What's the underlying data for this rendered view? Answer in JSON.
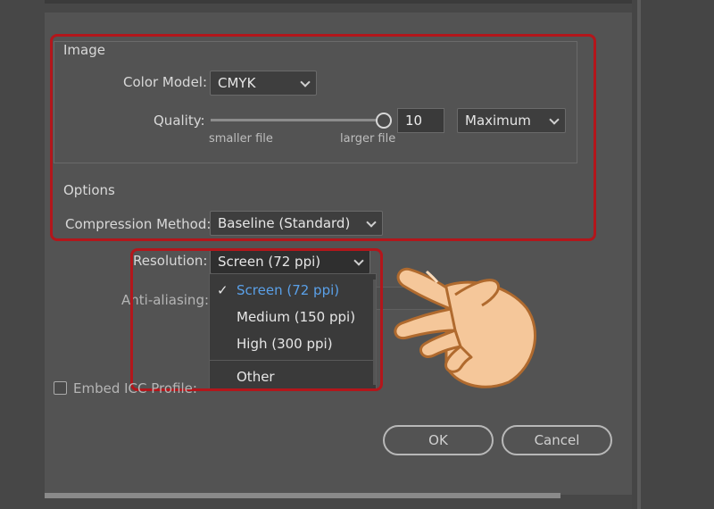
{
  "image_group": {
    "title": "Image",
    "color_model_label": "Color Model:",
    "color_model_value": "CMYK",
    "quality_label": "Quality:",
    "quality_value": "10",
    "quality_level": 1.0,
    "quality_preset": "Maximum",
    "smaller_file_label": "smaller file",
    "larger_file_label": "larger file"
  },
  "options_group": {
    "title": "Options",
    "compression_label": "Compression Method:",
    "compression_value": "Baseline (Standard)"
  },
  "resolution": {
    "label": "Resolution:",
    "value": "Screen (72 ppi)",
    "options": [
      "Screen (72 ppi)",
      "Medium (150 ppi)",
      "High (300 ppi)",
      "Other"
    ],
    "checkmark": "✓"
  },
  "anti_aliasing": {
    "label": "Anti-aliasing:"
  },
  "embed_icc": {
    "label": "Embed ICC Profile:"
  },
  "buttons": {
    "ok": "OK",
    "cancel": "Cancel"
  },
  "colors": {
    "highlight_red": "#b3161b",
    "selected_blue": "#5aa0e8",
    "hand_skin": "#f5c79a"
  },
  "icons": {
    "pointer": "pointing-hand-icon",
    "chevron": "chevron-down-icon",
    "check": "checkmark-icon"
  }
}
